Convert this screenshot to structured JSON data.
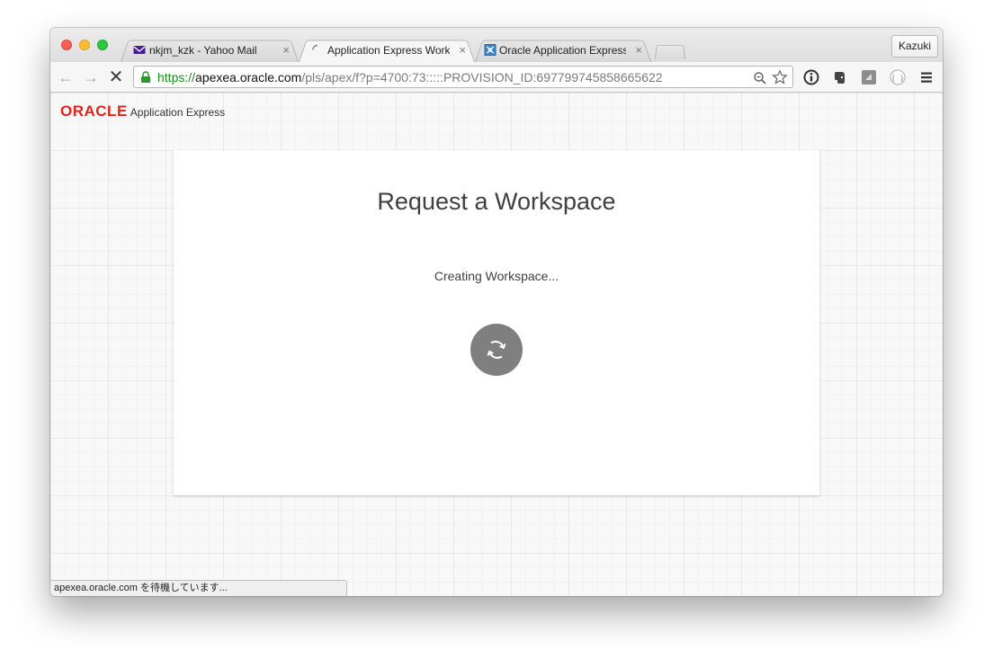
{
  "profile": {
    "name": "Kazuki"
  },
  "tabs": [
    {
      "title": "nkjm_kzk - Yahoo Mail",
      "icon": "mail-icon",
      "active": false
    },
    {
      "title": "Application Express Worksp",
      "icon": "loading-spinner-icon",
      "active": true
    },
    {
      "title": "Oracle Application Express",
      "icon": "apex-icon",
      "active": false
    }
  ],
  "tab_close_glyph": "×",
  "toolbar": {
    "url_scheme": "https://",
    "url_host": "apexea.oracle.com",
    "url_path": "/pls/apex/f?p=4700:73:::::PROVISION_ID:697799745858665622",
    "back_glyph": "←",
    "forward_glyph": "→",
    "stop_glyph": "✕"
  },
  "page": {
    "brand_logo": "ORACLE",
    "brand_product": "Application Express",
    "card_title": "Request a Workspace",
    "status_message": "Creating Workspace..."
  },
  "statusbar": {
    "text": "apexea.oracle.com を待機しています..."
  },
  "colors": {
    "oracle_red": "#e2231a",
    "url_green": "#1a8d1a",
    "spinner_gray": "#7f7f7f"
  }
}
